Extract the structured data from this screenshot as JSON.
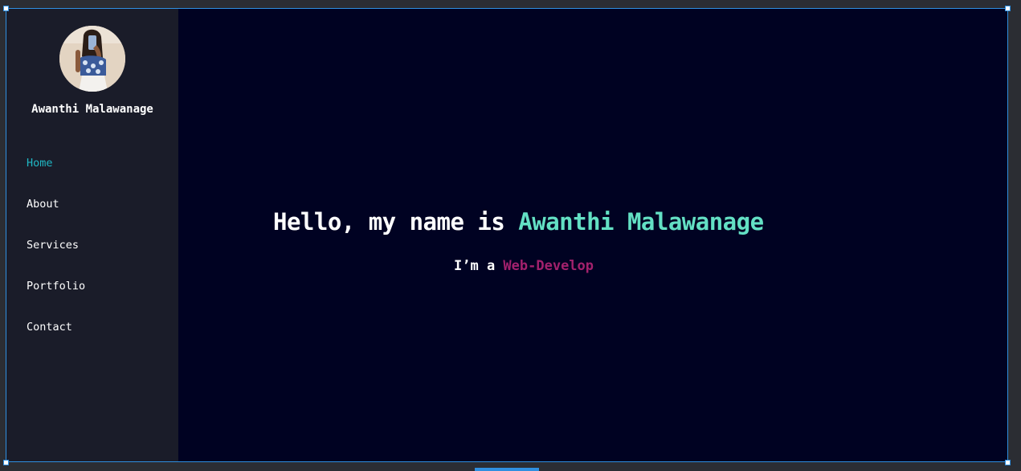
{
  "sidebar": {
    "profile_name": "Awanthi Malawanage",
    "nav": [
      {
        "label": "Home",
        "active": true
      },
      {
        "label": "About",
        "active": false
      },
      {
        "label": "Services",
        "active": false
      },
      {
        "label": "Portfolio",
        "active": false
      },
      {
        "label": "Contact",
        "active": false
      }
    ]
  },
  "hero": {
    "greeting": "Hello, my name is ",
    "name": "Awanthi Malawanage",
    "role_prefix": "I’m a ",
    "role": "Web-Develop"
  },
  "colors": {
    "page_bg": "#000222",
    "sidebar_bg": "#1a1c29",
    "nav_active": "#20b7c4",
    "name_accent": "#63e0c4",
    "role_accent": "#a3216d",
    "selection_border": "#2f8fe0"
  }
}
